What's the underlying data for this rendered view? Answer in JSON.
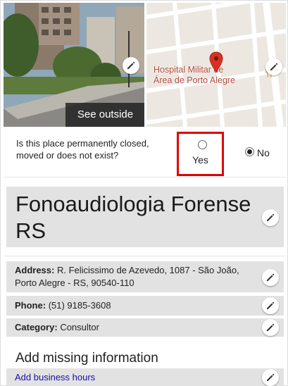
{
  "photo": {
    "see_outside_label": "See outside"
  },
  "map": {
    "place_line1": "Hospital Militar de",
    "place_line2": "Área de Porto Alegre"
  },
  "closed_question": {
    "text": "Is this place permanently closed, moved or does not exist?",
    "yes_label": "Yes",
    "no_label": "No",
    "selected": "No"
  },
  "business": {
    "name": "Fonoaudiologia Forense RS",
    "address_label": "Address:",
    "address_value": "R. Felicissimo de Azevedo, 1087 - São João, Porto Alegre - RS, 90540-110",
    "phone_label": "Phone:",
    "phone_value": "(51) 9185-3608",
    "category_label": "Category:",
    "category_value": "Consultor"
  },
  "missing": {
    "heading": "Add missing information",
    "add_hours_link": "Add business hours"
  },
  "icons": {
    "edit": "pencil-icon",
    "map_pin": "map-pin-icon",
    "restaurant": "fork-knife-icon"
  },
  "colors": {
    "highlight_border": "#e00000",
    "link": "#1a0dab",
    "map_pin": "#d93025",
    "band": "#e2e2e2"
  }
}
